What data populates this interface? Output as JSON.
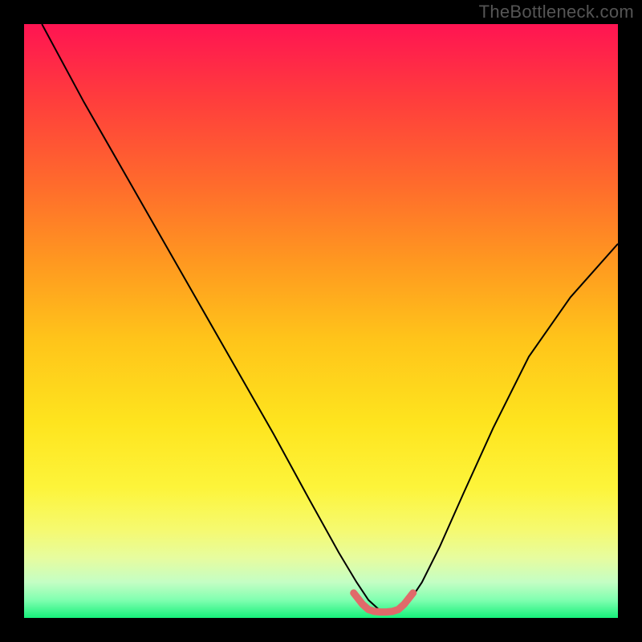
{
  "watermark": "TheBottleneck.com",
  "gradient": {
    "stops": [
      {
        "offset": "0%",
        "color": "#FF1452"
      },
      {
        "offset": "13%",
        "color": "#FF3E3C"
      },
      {
        "offset": "27%",
        "color": "#FF6B2C"
      },
      {
        "offset": "40%",
        "color": "#FF9820"
      },
      {
        "offset": "53%",
        "color": "#FFC41A"
      },
      {
        "offset": "67%",
        "color": "#FEE41E"
      },
      {
        "offset": "78%",
        "color": "#FDF43A"
      },
      {
        "offset": "85%",
        "color": "#F6FA6E"
      },
      {
        "offset": "90%",
        "color": "#E6FCA0"
      },
      {
        "offset": "94%",
        "color": "#C4FEC4"
      },
      {
        "offset": "97%",
        "color": "#80FFB0"
      },
      {
        "offset": "100%",
        "color": "#16F07A"
      }
    ]
  },
  "chart_data": {
    "type": "line",
    "title": "",
    "xlabel": "",
    "ylabel": "",
    "xlim": [
      0,
      100
    ],
    "ylim": [
      0,
      100
    ],
    "grid": false,
    "legend": false,
    "series": [
      {
        "name": "curve",
        "color": "#000000",
        "stroke_width": 2,
        "x": [
          3,
          10,
          18,
          26,
          34,
          42,
          48,
          53,
          56,
          58,
          60,
          63,
          65,
          67,
          70,
          74,
          79,
          85,
          92,
          100
        ],
        "y": [
          100,
          87,
          73,
          59,
          45,
          31,
          20,
          11,
          6,
          3,
          1.2,
          1.2,
          3,
          6,
          12,
          21,
          32,
          44,
          54,
          63
        ]
      },
      {
        "name": "valley-highlight",
        "color": "#E06A6A",
        "stroke_width": 9,
        "linecap": "round",
        "x": [
          55.5,
          57,
          58,
          59,
          60,
          61,
          62,
          63,
          64,
          65.5
        ],
        "y": [
          4.2,
          2.3,
          1.4,
          1.1,
          1.0,
          1.0,
          1.1,
          1.4,
          2.3,
          4.2
        ]
      }
    ]
  }
}
